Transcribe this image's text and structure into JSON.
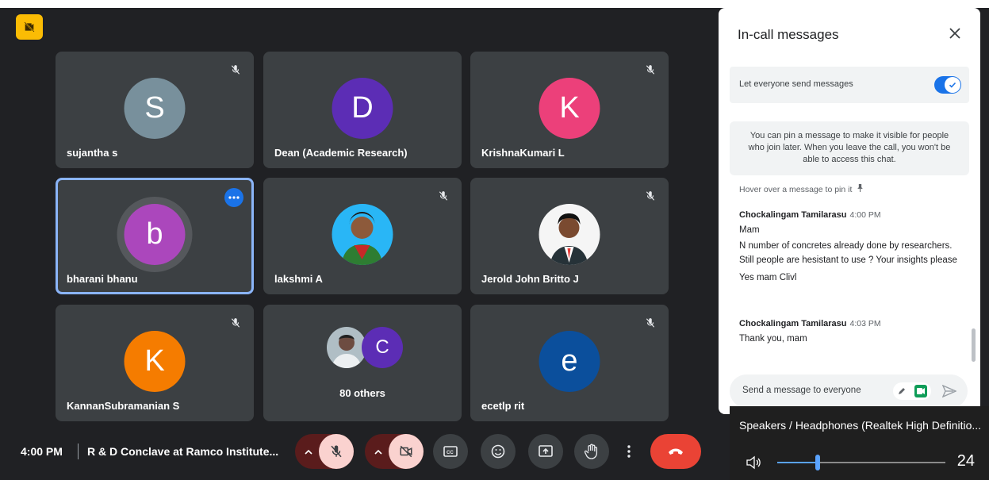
{
  "participants": [
    {
      "name": "sujantha s",
      "initial": "S",
      "color": "#78909c"
    },
    {
      "name": "Dean (Academic Research)",
      "initial": "D",
      "color": "#5c2db5"
    },
    {
      "name": "KrishnaKumari L",
      "initial": "K",
      "color": "#ec407a"
    },
    {
      "name": "bharani bhanu",
      "initial": "b",
      "color": "#ab47bc"
    },
    {
      "name": "lakshmi A",
      "initial": "",
      "color": "#29b6f6"
    },
    {
      "name": "Jerold John Britto J",
      "initial": "",
      "color": "#f5f5f5"
    },
    {
      "name": "KannanSubramanian S",
      "initial": "K",
      "color": "#f57c00"
    },
    {
      "name": "80 others",
      "initial": "C",
      "color": "#5c2db5"
    },
    {
      "name": "ecetlp rit",
      "initial": "e",
      "color": "#0b4f9c"
    }
  ],
  "chat": {
    "title": "In-call messages",
    "setting_label": "Let everyone send messages",
    "pin_info": "You can pin a message to make it visible for people who join later. When you leave the call, you won't be able to access this chat.",
    "hover_hint": "Hover over a message to pin it",
    "messages": [
      {
        "author": "Chockalingam Tamilarasu",
        "time": "4:00 PM",
        "lines": [
          "Mam",
          "N number of concretes already done by researchers. Still people are hesistant to use ? Your insights please",
          "Yes mam Clivl"
        ]
      },
      {
        "author": "Chockalingam Tamilarasu",
        "time": "4:03 PM",
        "lines": [
          "Thank you, mam"
        ]
      }
    ],
    "compose_placeholder": "Send a message to everyone"
  },
  "meeting": {
    "time": "4:00 PM",
    "title": "R & D Conclave at Ramco Institute..."
  },
  "audio": {
    "device": "Speakers / Headphones (Realtek High Definitio...",
    "level": "24",
    "level_fraction": 0.24
  }
}
